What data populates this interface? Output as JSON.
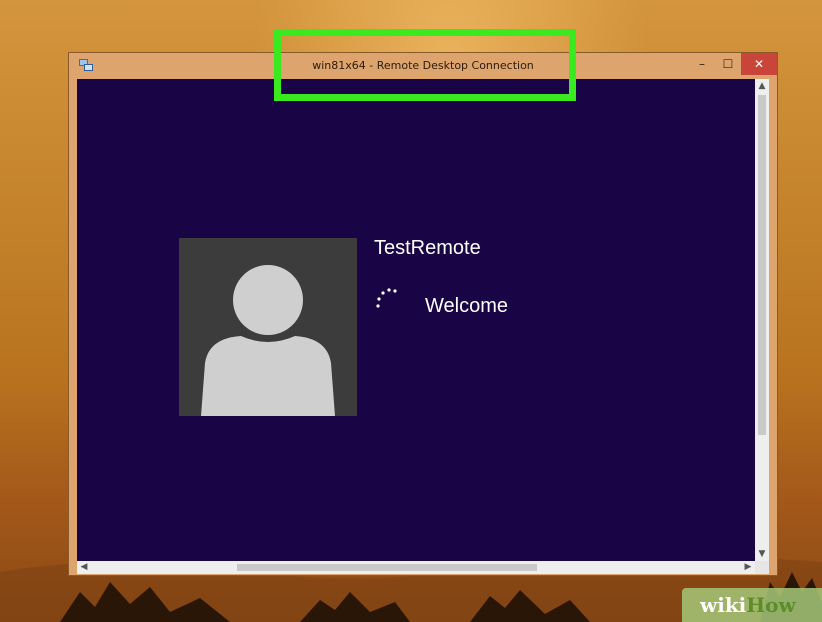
{
  "window": {
    "title": "win81x64 - Remote Desktop Connection",
    "controls": {
      "minimize": "–",
      "maximize": "☐",
      "close": "✕"
    }
  },
  "login": {
    "username": "TestRemote",
    "status": "Welcome"
  },
  "scrollbars": {
    "up": "▲",
    "down": "▼",
    "left": "◀",
    "right": "▶"
  },
  "watermark": {
    "part1": "wiki",
    "part2": "How"
  },
  "colors": {
    "session_background": "#190445",
    "highlight_box": "#3bea1e",
    "close_button": "#c9453a"
  }
}
